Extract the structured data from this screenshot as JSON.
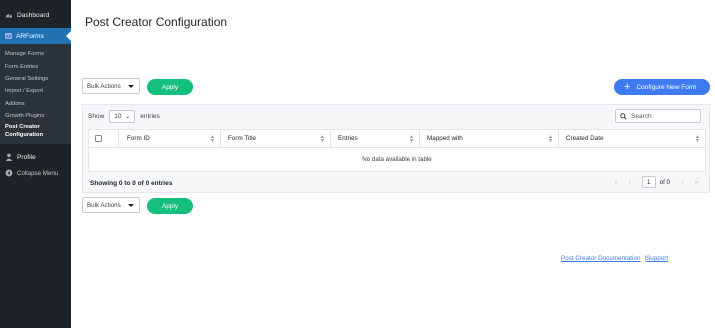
{
  "sidebar": {
    "dashboard": "Dashboard",
    "plugin": "ARForms",
    "plugin_logo": "AF",
    "submenu": [
      {
        "label": "Manage Forms"
      },
      {
        "label": "Form Entries"
      },
      {
        "label": "General Settings"
      },
      {
        "label": "Import / Export"
      },
      {
        "label": "Addons"
      },
      {
        "label": "Growth Plugins"
      }
    ],
    "current": "Post Creator Configuration",
    "profile": "Profile",
    "collapse": "Collapse Menu"
  },
  "page": {
    "title": "Post Creator Configuration"
  },
  "bulk_top": {
    "label": "Bulk Actions",
    "apply": "Apply"
  },
  "bulk_bottom": {
    "label": "Bulk Actions",
    "apply": "Apply"
  },
  "configure_button": "Configure New Form",
  "table": {
    "show_label": "Show",
    "page_size": "10",
    "entries_label": "entries",
    "search_placeholder": "Search",
    "columns": [
      "Form ID",
      "Form Title",
      "Entries",
      "Mapped with",
      "Created Date"
    ],
    "empty_message": "No data available in table",
    "info": "Showing 0 to 0 of 0 entries",
    "current_page": "1",
    "of_pages": "of 0"
  },
  "footer": {
    "doc_link": "Post Creator Documentation",
    "separator": "|",
    "support_link": "Support"
  },
  "colors": {
    "sidebar_bg": "#1d2327",
    "active_menu": "#2271b1",
    "apply_green": "#15c07f",
    "configure_blue": "#3e7bf0"
  },
  "icons": {
    "dashboard": "dashboard-icon",
    "profile": "user-icon",
    "collapse": "collapse-icon",
    "search": "search-icon",
    "plus": "plus-icon"
  }
}
